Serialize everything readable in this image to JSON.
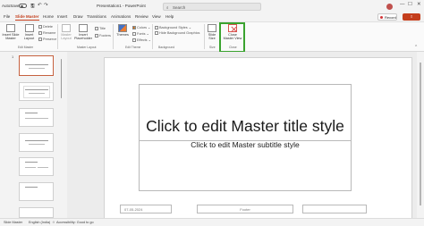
{
  "titlebar": {
    "autosave": "AutoSave",
    "doc_title": "Presentation1 - PowerPoint",
    "search_placeholder": "Search",
    "avatar_initials": "",
    "minimize": "—",
    "maximize": "☐",
    "close": "✕"
  },
  "tabs": [
    "File",
    "Slide Master",
    "Home",
    "Insert",
    "Draw",
    "Transitions",
    "Animations",
    "Review",
    "View",
    "Help"
  ],
  "actions": {
    "record": "Record"
  },
  "ribbon": {
    "insert_slide_master": "Insert Slide Master",
    "insert_layout": "Insert Layout",
    "delete": "Delete",
    "rename": "Rename",
    "preserve": "Preserve",
    "master_layout": "Master Layout",
    "insert_placeholder": "Insert Placeholder",
    "title": "Title",
    "footers": "Footers",
    "themes": "Themes",
    "colors": "Colors",
    "fonts": "Fonts",
    "effects": "Effects",
    "background_styles": "Background Styles",
    "hide_background_graphics": "Hide Background Graphics",
    "slide_size": "Slide Size",
    "close_master_view": "Close Master View",
    "groups": {
      "edit_master": "Edit Master",
      "master_layout": "Master Layout",
      "edit_theme": "Edit Theme",
      "background": "Background",
      "size": "Size",
      "close": "Close"
    }
  },
  "thumbnails": [
    "1",
    "",
    "",
    "",
    "",
    "",
    "",
    "",
    ""
  ],
  "slide": {
    "title": "Click to edit Master title style",
    "subtitle": "Click to edit Master subtitle style",
    "footer_date": "07-05-2024",
    "footer_text": "Footer",
    "footer_number": ""
  },
  "status": {
    "view": "Slide Master",
    "language": "English (India)",
    "accessibility": "Accessibility: Good to go"
  }
}
